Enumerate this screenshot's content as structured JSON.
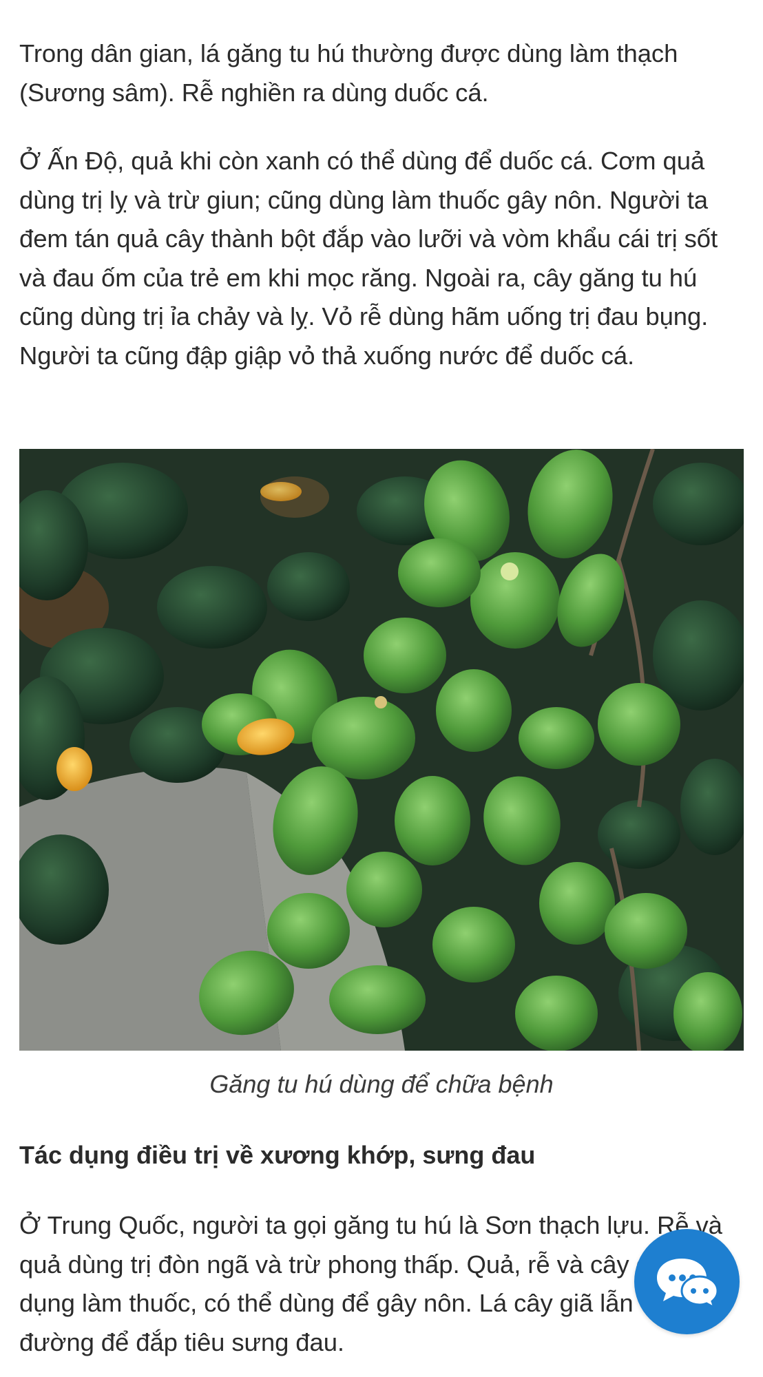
{
  "article": {
    "paragraph_1": "Trong dân gian, lá găng tu hú thường được dùng làm thạch (Sương sâm). Rễ nghiền ra dùng duốc cá.",
    "paragraph_2": "Ở Ấn Độ, quả khi còn xanh có thể dùng để duốc cá. Cơm quả dùng trị lỵ và trừ giun; cũng dùng làm thuốc gây nôn. Người ta đem tán quả cây thành bột đắp vào lưỡi và vòm khẩu cái trị sốt và đau ốm của trẻ em khi mọc răng. Ngoài ra, cây găng tu hú cũng dùng trị ỉa chảy và lỵ. Vỏ rễ dùng hãm uống trị đau bụng. Người ta cũng đập giập vỏ thả xuống nước để duốc cá.",
    "image_caption": "Găng tu hú dùng để chữa bệnh",
    "section_heading": "Tác dụng điều trị về xương khớp, sưng đau",
    "paragraph_3": "Ở Trung Quốc, người ta gọi găng tu hú là Sơn thạch lựu. Rễ và quả dùng trị đòn ngã và trừ phong thấp. Quả, rễ và cây được sử dụng làm thuốc, có thể dùng để gây nôn. Lá cây giã lẫn với đường để đắp tiêu sưng đau."
  },
  "chat_widget": {
    "icon": "chat-bubbles-icon",
    "color": "#1e7fd0"
  }
}
